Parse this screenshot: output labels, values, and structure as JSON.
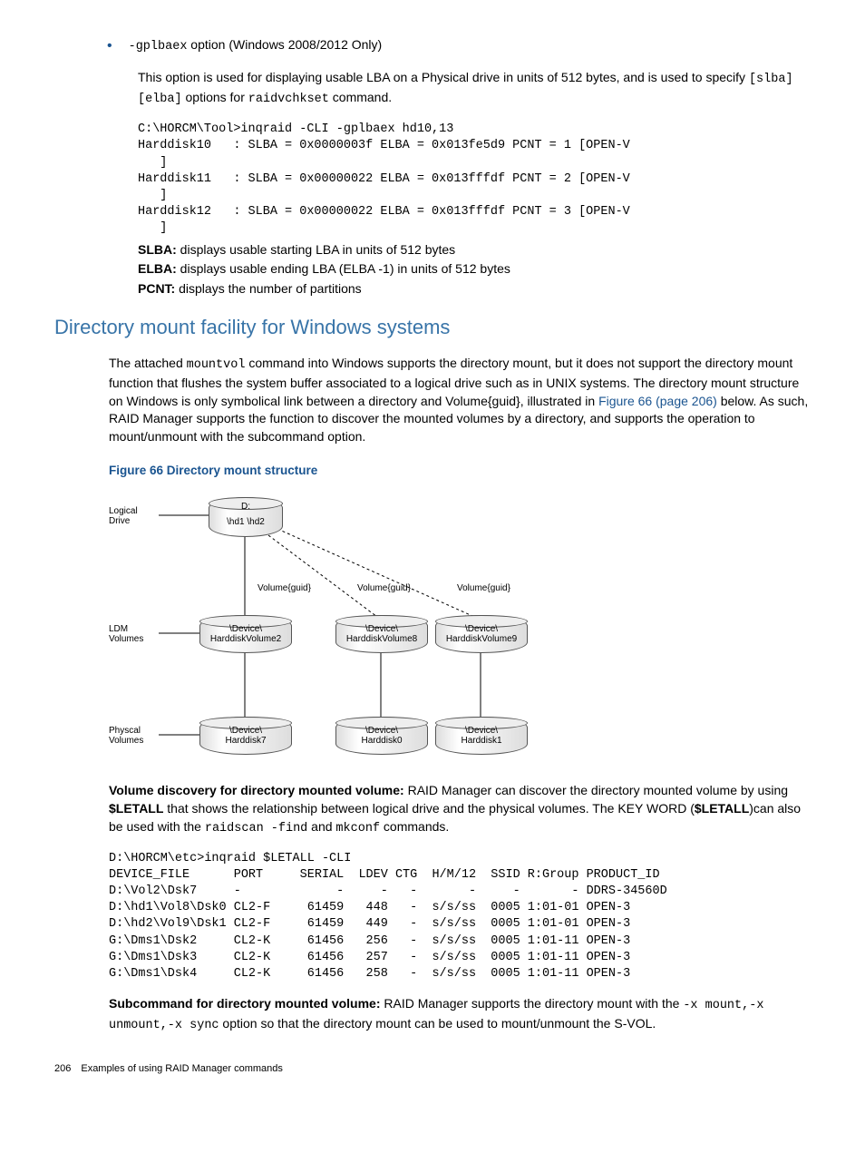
{
  "bullet": {
    "option_code": "-gplbaex",
    "option_suffix": " option (Windows 2008/2012 Only)",
    "desc_part1": "This option is used for displaying usable LBA on a Physical drive in units of 512 bytes, and is used to specify ",
    "code_slba_elba": "[slba] [elba]",
    "desc_part2": " options for ",
    "code_cmd": "raidvchkset",
    "desc_part3": " command."
  },
  "code1": "C:\\HORCM\\Tool>inqraid -CLI -gplbaex hd10,13\nHarddisk10   : SLBA = 0x0000003f ELBA = 0x013fe5d9 PCNT = 1 [OPEN-V\n   ]\nHarddisk11   : SLBA = 0x00000022 ELBA = 0x013fffdf PCNT = 2 [OPEN-V\n   ]\nHarddisk12   : SLBA = 0x00000022 ELBA = 0x013fffdf PCNT = 3 [OPEN-V\n   ]",
  "defs": {
    "slba_lbl": "SLBA:",
    "slba_txt": " displays usable starting LBA in units of 512 bytes",
    "elba_lbl": "ELBA:",
    "elba_txt": " displays usable ending LBA (ELBA -1) in units of 512 bytes",
    "pcnt_lbl": "PCNT:",
    "pcnt_txt": " displays the number of partitions"
  },
  "section_title": "Directory mount facility for Windows systems",
  "section_p_a": "The attached ",
  "section_code1": "mountvol",
  "section_p_b": " command into Windows supports the directory mount, but it does not support the directory mount function that flushes the system buffer associated to a logical drive such as in UNIX systems. The directory mount structure on Windows is only symbolical link between a directory and Volume{guid}, illustrated in ",
  "section_link": "Figure 66 (page 206)",
  "section_p_c": " below. As such, RAID Manager supports the function to discover the mounted volumes by a directory, and supports the operation to mount/unmount with the subcommand option.",
  "figure_caption": "Figure 66 Directory mount structure",
  "diagram": {
    "logical_drive": "Logical\nDrive",
    "d_label": "D:",
    "d_sub": "\\hd1 \\hd2",
    "volguid": "Volume{guid}",
    "ldm_volumes": "LDM\nVolumes",
    "hdv2": "\\Device\\\nHarddiskVolume2",
    "hdv8": "\\Device\\\nHarddiskVolume8",
    "hdv9": "\\Device\\\nHarddiskVolume9",
    "phys_volumes": "Physcal\nVolumes",
    "hd7": "\\Device\\\nHarddisk7",
    "hd0": "\\Device\\\nHarddisk0",
    "hd1": "\\Device\\\nHarddisk1"
  },
  "vd_lbl": "Volume discovery for directory mounted volume:",
  "vd_a": " RAID Manager can discover the directory mounted volume by using ",
  "vd_letall1": "$LETALL",
  "vd_b": " that shows the relationship between logical drive and the physical volumes. The KEY WORD (",
  "vd_letall2": "$LETALL",
  "vd_c": ")can also be used with the ",
  "vd_code1": "raidscan -find",
  "vd_d": " and ",
  "vd_code2": "mkconf",
  "vd_e": " commands.",
  "code2": "D:\\HORCM\\etc>inqraid $LETALL -CLI\nDEVICE_FILE      PORT     SERIAL  LDEV CTG  H/M/12  SSID R:Group PRODUCT_ID\nD:\\Vol2\\Dsk7     -             -     -   -       -     -       - DDRS-34560D\nD:\\hd1\\Vol8\\Dsk0 CL2-F     61459   448   -  s/s/ss  0005 1:01-01 OPEN-3\nD:\\hd2\\Vol9\\Dsk1 CL2-F     61459   449   -  s/s/ss  0005 1:01-01 OPEN-3\nG:\\Dms1\\Dsk2     CL2-K     61456   256   -  s/s/ss  0005 1:01-11 OPEN-3\nG:\\Dms1\\Dsk3     CL2-K     61456   257   -  s/s/ss  0005 1:01-11 OPEN-3\nG:\\Dms1\\Dsk4     CL2-K     61456   258   -  s/s/ss  0005 1:01-11 OPEN-3",
  "sc_lbl": "Subcommand for directory mounted volume:",
  "sc_a": " RAID Manager supports the directory mount with the ",
  "sc_code": "-x mount,-x unmount,-x sync",
  "sc_b": " option so that the directory mount can be used to mount/unmount the S-VOL.",
  "footer": "206 Examples of using RAID Manager commands"
}
